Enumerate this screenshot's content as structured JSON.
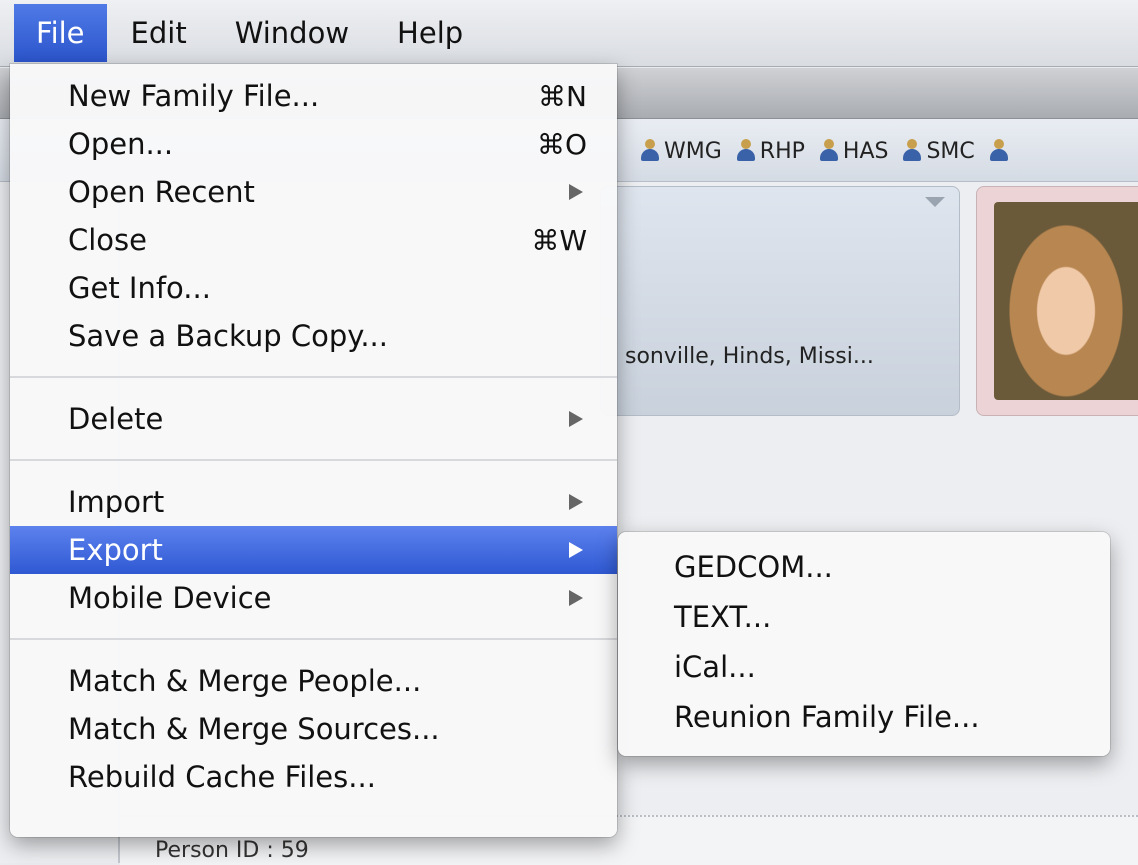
{
  "menubar": {
    "items": [
      "File",
      "Edit",
      "Window",
      "Help"
    ],
    "active_index": 0
  },
  "file_menu": {
    "groups": [
      [
        {
          "label": "New Family File...",
          "shortcut": "⌘N"
        },
        {
          "label": "Open...",
          "shortcut": "⌘O"
        },
        {
          "label": "Open Recent",
          "submenu": true
        },
        {
          "label": "Close",
          "shortcut": "⌘W"
        },
        {
          "label": "Get Info..."
        },
        {
          "label": "Save a Backup Copy..."
        }
      ],
      [
        {
          "label": "Delete",
          "submenu": true
        }
      ],
      [
        {
          "label": "Import",
          "submenu": true
        },
        {
          "label": "Export",
          "submenu": true,
          "highlighted": true
        },
        {
          "label": "Mobile Device",
          "submenu": true
        }
      ],
      [
        {
          "label": "Match & Merge People..."
        },
        {
          "label": "Match & Merge Sources..."
        },
        {
          "label": "Rebuild Cache Files..."
        }
      ]
    ]
  },
  "export_submenu": {
    "items": [
      "GEDCOM...",
      "TEXT...",
      "iCal...",
      "Reunion Family File..."
    ]
  },
  "background": {
    "tags": [
      "WMG",
      "RHP",
      "HAS",
      "SMC"
    ],
    "card_place_text": "sonville, Hinds, Missi...",
    "person_id_label": "Person ID",
    "person_id_value": "59"
  },
  "colors": {
    "highlight": "#3a63dc",
    "menu_bg": "#f8f8f9",
    "photo_card": "#ecd3d6"
  }
}
